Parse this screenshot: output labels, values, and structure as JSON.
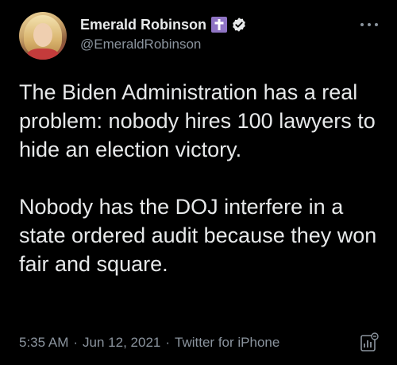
{
  "tweet": {
    "author": {
      "display_name": "Emerald Robinson",
      "handle": "@EmeraldRobinson",
      "badge_icon": "cross-icon",
      "verified_icon": "verified-badge-icon"
    },
    "text": "The Biden Administration has a real problem: nobody hires 100 lawyers to hide an election victory.\n\nNobody has the DOJ interfere in a state ordered audit because they won fair and square.",
    "time": "5:35 AM",
    "date": "Jun 12, 2021",
    "source": "Twitter for iPhone",
    "separator": "·"
  },
  "colors": {
    "background": "#000000",
    "text": "#e7e9ea",
    "secondary": "#8b949e",
    "cross_badge": "#8f74c4"
  }
}
